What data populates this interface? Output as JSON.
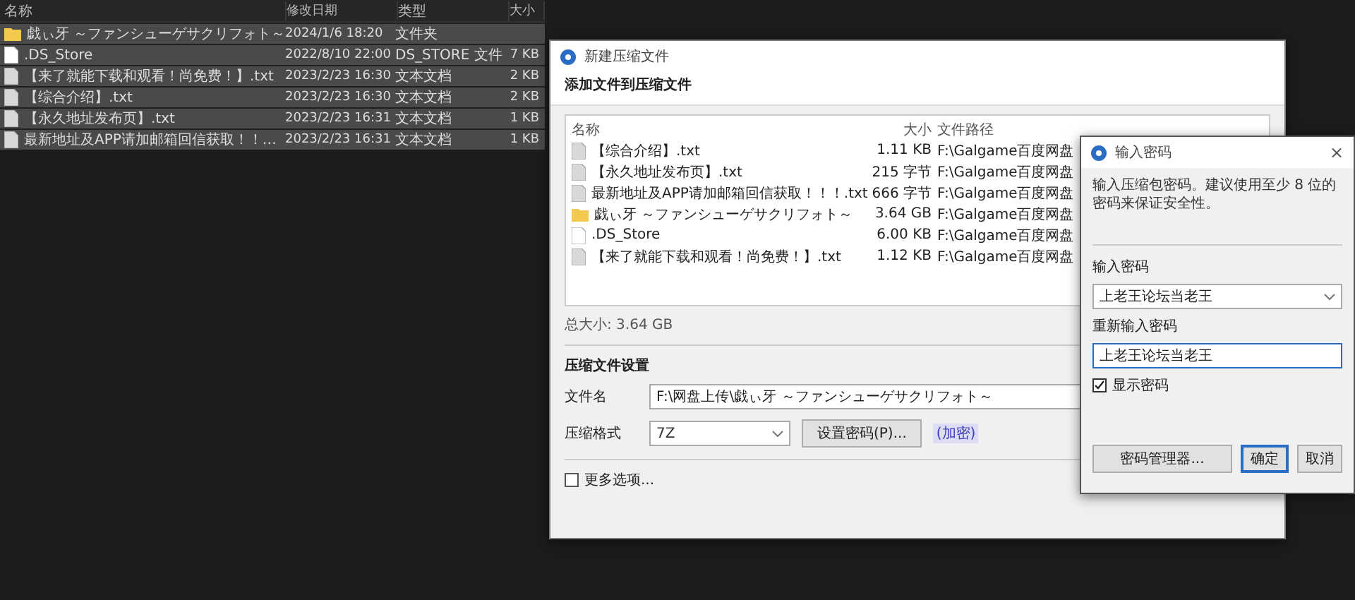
{
  "explorer": {
    "columns": [
      "名称",
      "修改日期",
      "类型",
      "大小"
    ],
    "rows": [
      {
        "kind": "folder",
        "name": "戯ぃ牙 ～ファンシューゲサクリフォト～",
        "modified": "2024/1/6 18:20",
        "type": "文件夹",
        "selected": true
      },
      {
        "kind": "file",
        "name": ".DS_Store",
        "modified": "2022/8/10 22:00",
        "type": "DS_STORE 文件",
        "size": "7 KB",
        "selected": true
      },
      {
        "kind": "text",
        "name": "【来了就能下载和观看！尚免费！】.txt",
        "modified": "2023/2/23 16:30",
        "type": "文本文档",
        "size": "2 KB",
        "selected": true
      },
      {
        "kind": "text",
        "name": "【综合介绍】.txt",
        "modified": "2023/2/23 16:30",
        "type": "文本文档",
        "size": "2 KB",
        "selected": true
      },
      {
        "kind": "text",
        "name": "【永久地址发布页】.txt",
        "modified": "2023/2/23 16:31",
        "type": "文本文档",
        "size": "1 KB",
        "selected": true
      },
      {
        "kind": "text",
        "name": "最新地址及APP请加邮箱回信获取！！…",
        "modified": "2023/2/23 16:31",
        "type": "文本文档",
        "size": "1 KB",
        "selected": true
      }
    ]
  },
  "archive_dialog": {
    "title": "新建压缩文件",
    "section": "添加文件到压缩文件",
    "columns": [
      "名称",
      "大小",
      "文件路径"
    ],
    "files": [
      {
        "kind": "text",
        "name": "【综合介绍】.txt",
        "size": "1.11 KB",
        "path": "F:\\Galgame百度网盘"
      },
      {
        "kind": "text",
        "name": "【永久地址发布页】.txt",
        "size": "215 字节",
        "path": "F:\\Galgame百度网盘"
      },
      {
        "kind": "text",
        "name": "最新地址及APP请加邮箱回信获取！！！.txt",
        "size": "666 字节",
        "path": "F:\\Galgame百度网盘"
      },
      {
        "kind": "folder",
        "name": "戯ぃ牙 ～ファンシューゲサクリフォト～",
        "size": "3.64 GB",
        "path": "F:\\Galgame百度网盘"
      },
      {
        "kind": "file",
        "name": ".DS_Store",
        "size": "6.00 KB",
        "path": "F:\\Galgame百度网盘"
      },
      {
        "kind": "text",
        "name": "【来了就能下载和观看！尚免费！】.txt",
        "size": "1.12 KB",
        "path": "F:\\Galgame百度网盘"
      }
    ],
    "total": "总大小: 3.64 GB",
    "settings_title": "压缩文件设置",
    "filename_label": "文件名",
    "filename": "F:\\网盘上传\\戯ぃ牙 ～ファンシューゲサクリフォト～",
    "format_label": "压缩格式",
    "format": "7Z",
    "set_password_button": "设置密码(P)...",
    "encrypted_label": "(加密)",
    "more_options": {
      "label": "更多选项...",
      "checked": false
    }
  },
  "password_dialog": {
    "title": "输入密码",
    "close": "×",
    "hint": "输入压缩包密码。建议使用至少 8 位的密码来保证安全性。",
    "password_label": "输入密码",
    "password": {
      "value": "上老王论坛当老王",
      "focused": false
    },
    "confirm_label": "重新输入密码",
    "confirm": {
      "value": "上老王论坛当老王",
      "focused": true
    },
    "show_password": {
      "label": "显示密码",
      "checked": true
    },
    "buttons": [
      {
        "label": "密码管理器...",
        "default": false
      },
      {
        "label": "确定",
        "default": true
      },
      {
        "label": "取消",
        "default": false
      }
    ]
  }
}
